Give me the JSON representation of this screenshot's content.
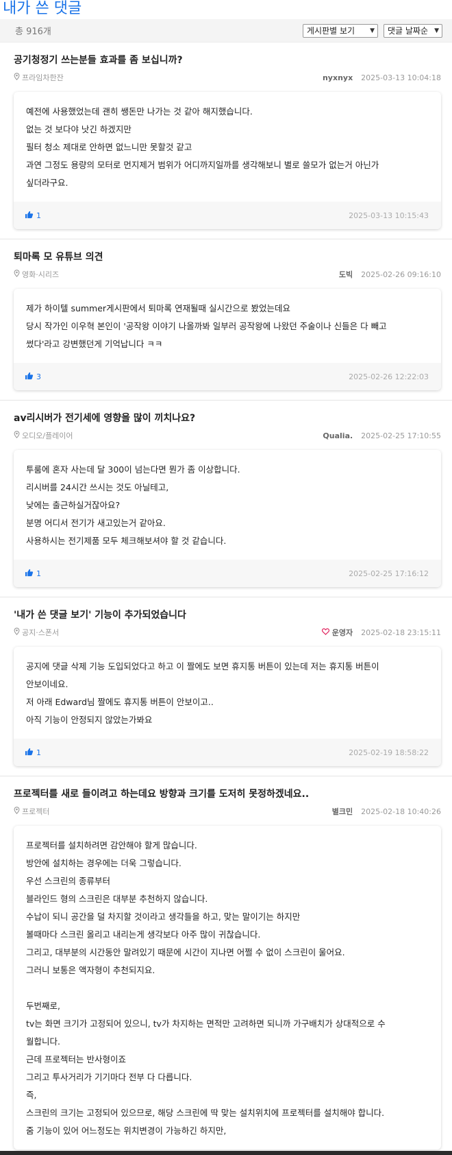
{
  "page": {
    "title": "내가 쓴 댓글"
  },
  "toolbar": {
    "total": "총 916개",
    "board_filter": "게시판별 보기",
    "sort": "댓글 날짜순"
  },
  "colors": {
    "accent": "#1a73e8",
    "heart": "#e0245e"
  },
  "posts": [
    {
      "title": "공기청정기 쓰는분들 효과를 좀 보십니까?",
      "category": "프라임차한잔",
      "author": "nyxnyx",
      "date": "2025-03-13 10:04:18",
      "comment_lines": [
        "예전에 사용했었는데 괜히 쌩돈만 나가는 것 같아 해지했습니다.",
        "없는 것 보다야 낫긴 하겠지만",
        "필터 청소 제대로 안하면 없느니만 못할것 같고",
        "과연 그정도 용량의 모터로 먼지제거 범위가 어디까지일까를 생각해보니 별로 쓸모가 없는거 아닌가",
        "싶더라구요."
      ],
      "likes": "1",
      "comment_date": "2025-03-13 10:15:43"
    },
    {
      "title": "퇴마록 모 유튜브 의견",
      "category": "영화·시리즈",
      "author": "도빅",
      "date": "2025-02-26 09:16:10",
      "comment_lines": [
        "제가 하이텔 summer게시판에서 퇴마록 연재될때 실시간으로 봤었는데요",
        "당시 작가인 이우혁 본인이 '공작왕 이야기 나올까봐 일부러 공작왕에 나왔던 주술이나 신들은 다 빼고",
        "썼다'라고 강변했던게 기억납니다 ㅋㅋ"
      ],
      "likes": "3",
      "comment_date": "2025-02-26 12:22:03"
    },
    {
      "title": "av리시버가 전기세에 영향을 많이 끼치나요?",
      "category": "오디오/플레이어",
      "author": "Qualia.",
      "date": "2025-02-25 17:10:55",
      "comment_lines": [
        "투룸에 혼자 사는데 달 300이 넘는다면 뭔가 좀 이상합니다.",
        "리시버를 24시간 쓰시는 것도 아닐테고,",
        "낮에는 출근하실거잖아요?",
        "분명 어디서 전기가 새고있는거 같아요.",
        "사용하시는 전기제품 모두 체크해보셔야 할 것 같습니다."
      ],
      "likes": "1",
      "comment_date": "2025-02-25 17:16:12"
    },
    {
      "title": "'내가 쓴 댓글 보기' 기능이 추가되었습니다",
      "category": "공지·스폰서",
      "author": "운영자",
      "author_heart": true,
      "date": "2025-02-18 23:15:11",
      "comment_lines": [
        "공지에 댓글 삭제 기능 도입되었다고 하고 이 짤에도 보면 휴지통 버튼이 있는데 저는 휴지통 버튼이",
        "안보이네요.",
        "저 아래 Edward님 짤에도 휴지통 버튼이 안보이고..",
        "아직 기능이 안정되지 않았는가봐요"
      ],
      "likes": "1",
      "comment_date": "2025-02-19 18:58:22"
    },
    {
      "title": "프로젝터를 새로 들이려고 하는데요 방향과 크기를 도저히 못정하겠네요..",
      "category": "프로젝터",
      "author": "별크민",
      "date": "2025-02-18 10:40:26",
      "comment_lines": [
        "프로젝터를 설치하려면 감안해야 할게 많습니다.",
        "방안에 설치하는 경우에는 더욱 그렇습니다.",
        "우선 스크린의 종류부터",
        "블라인드 형의 스크린은 대부분 추천하지 않습니다.",
        "수납이 되니 공간을 덜 차지할 것이라고 생각들을 하고, 맞는 말이기는 하지만",
        "볼때마다 스크린 올리고 내리는게 생각보다 아주 많이 귀찮습니다.",
        "그리고, 대부분의 시간동안 말려있기 때문에 시간이 지나면 어쩔 수 없이 스크린이 울어요.",
        "그러니 보통은 액자형이 추천되지요.",
        "",
        "두번째로,",
        "tv는 화면 크기가 고정되어 있으니, tv가 차지하는 면적만 고려하면 되니까 가구배치가 상대적으로 수",
        "월합니다.",
        "근데 프로젝터는 반사형이죠",
        "그리고 투사거리가 기기마다 전부 다 다릅니다.",
        "즉,",
        "스크린의 크기는 고정되어 있으므로, 해당 스크린에 딱 맞는 설치위치에 프로젝터를 설치해야 합니다.",
        "줌 기능이 있어 어느정도는 위치변경이 가능하긴 하지만,"
      ]
    }
  ]
}
